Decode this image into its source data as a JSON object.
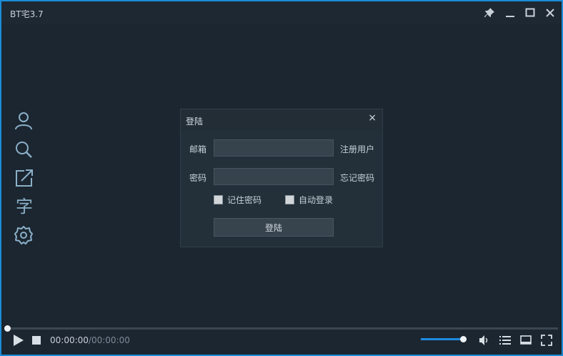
{
  "window": {
    "title": "BT宅3.7"
  },
  "titlebar": {
    "pin_icon": "pin-icon",
    "minimize_icon": "minimize-icon",
    "maximize_icon": "maximize-icon",
    "close_icon": "close-icon"
  },
  "sidebar": {
    "items": [
      {
        "icon": "user-icon"
      },
      {
        "icon": "search-icon"
      },
      {
        "icon": "external-link-icon"
      },
      {
        "icon": "subtitle-icon",
        "glyph": "字"
      },
      {
        "icon": "settings-gear-icon"
      }
    ]
  },
  "login_dialog": {
    "title": "登陆",
    "close_glyph": "×",
    "email_label": "邮箱",
    "email_value": "",
    "register_link": "注册用户",
    "password_label": "密码",
    "password_value": "",
    "forgot_link": "忘记密码",
    "remember_label": "记住密码",
    "remember_checked": false,
    "autologin_label": "自动登录",
    "autologin_checked": false,
    "login_button": "登陆"
  },
  "player": {
    "time_current": "00:00:00",
    "time_separator": "/",
    "time_total": "00:00:00",
    "progress_fraction": 0,
    "volume_fraction": 0.92
  },
  "colors": {
    "accent": "#1e8be0",
    "window_bg": "#1c2630",
    "dialog_bg": "#233039"
  }
}
